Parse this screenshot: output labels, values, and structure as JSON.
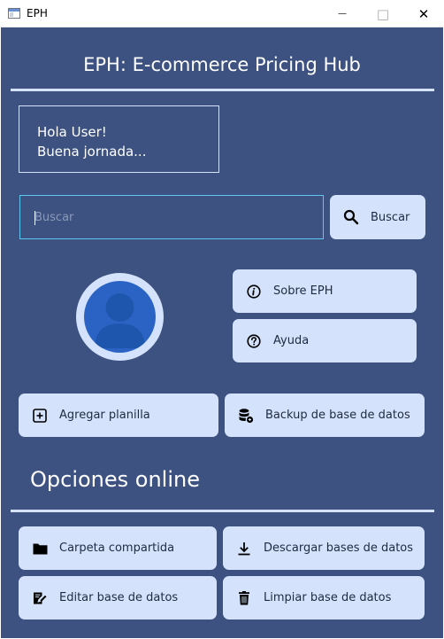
{
  "window": {
    "title": "EPH",
    "minimize_glyph": "—",
    "maximize_glyph": "□",
    "close_glyph": "✕"
  },
  "header": {
    "title": "EPH: E-commerce Pricing Hub"
  },
  "greeting": {
    "line1": "Hola User!",
    "line2": "Buena jornada..."
  },
  "search": {
    "placeholder": "Buscar",
    "value": "",
    "button_label": "Buscar",
    "button_icon": "search-icon"
  },
  "side_buttons": {
    "about": {
      "label": "Sobre EPH",
      "icon": "info-icon"
    },
    "help": {
      "label": "Ayuda",
      "icon": "help-icon"
    }
  },
  "actions": {
    "add_sheet": {
      "label": "Agregar planilla",
      "icon": "plus-square-icon"
    },
    "backup": {
      "label": "Backup de base de datos",
      "icon": "database-icon"
    }
  },
  "online": {
    "title": "Opciones online",
    "shared_folder": {
      "label": "Carpeta compartida",
      "icon": "folder-icon"
    },
    "download_db": {
      "label": "Descargar bases de datos",
      "icon": "download-icon"
    },
    "edit_db": {
      "label": "Editar base de datos",
      "icon": "edit-icon"
    },
    "clear_db": {
      "label": "Limpiar base de datos",
      "icon": "trash-icon"
    }
  },
  "colors": {
    "background": "#3d5280",
    "button": "#d4e3fb",
    "search_border": "#5fc4f0",
    "avatar": "#2b63c5"
  }
}
